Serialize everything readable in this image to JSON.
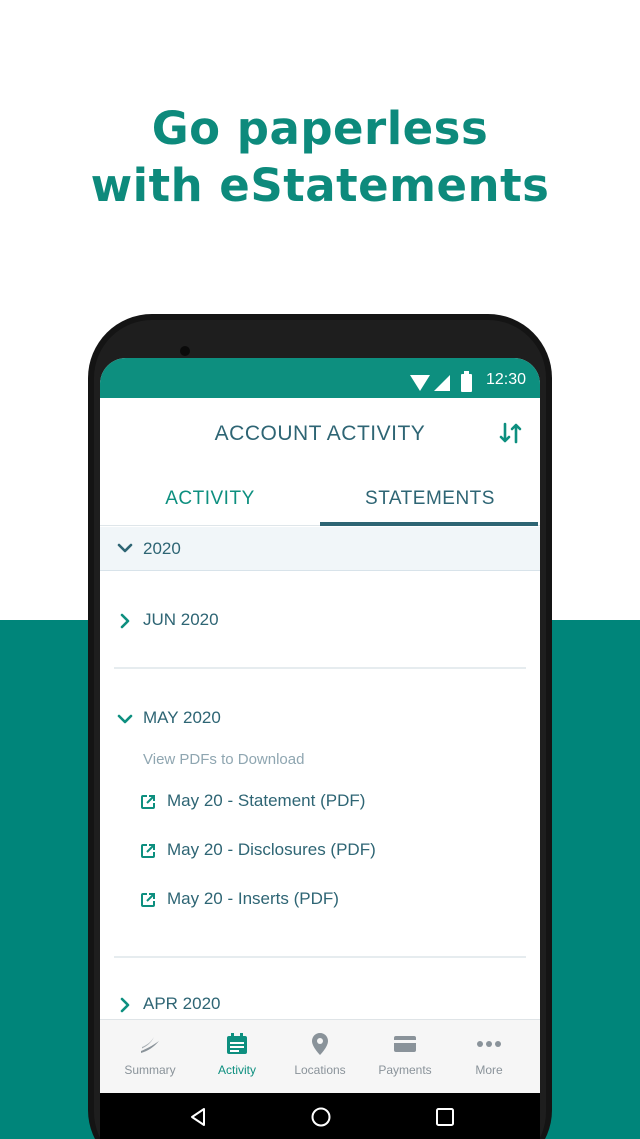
{
  "promo": {
    "headline_line1": "Go paperless",
    "headline_line2": "with eStatements"
  },
  "status_bar": {
    "time": "12:30",
    "icons": [
      "wifi-icon",
      "signal-icon",
      "battery-icon"
    ]
  },
  "header": {
    "title": "ACCOUNT ACTIVITY",
    "sort_icon": "sort-icon"
  },
  "tabs": [
    {
      "label": "ACTIVITY",
      "selected": false
    },
    {
      "label": "STATEMENTS",
      "selected": true
    }
  ],
  "statements": {
    "year": "2020",
    "months": [
      {
        "label": "JUN 2020",
        "expanded": false
      },
      {
        "label": "MAY 2020",
        "expanded": true
      },
      {
        "label": "APR 2020",
        "expanded": false
      }
    ],
    "hint": "View PDFs to Download",
    "pdfs": [
      "May 20 - Statement (PDF)",
      "May 20 - Disclosures (PDF)",
      "May 20 - Inserts (PDF)"
    ]
  },
  "bottom_nav": [
    {
      "label": "Summary",
      "icon": "summary-icon",
      "active": false
    },
    {
      "label": "Activity",
      "icon": "activity-icon",
      "active": true
    },
    {
      "label": "Locations",
      "icon": "location-pin-icon",
      "active": false
    },
    {
      "label": "Payments",
      "icon": "card-icon",
      "active": false
    },
    {
      "label": "More",
      "icon": "more-icon",
      "active": false
    }
  ],
  "colors": {
    "brand_teal": "#0d8f7f",
    "promo_bg": "#00857a",
    "text_dark_teal": "#2e6574",
    "inactive_gray": "#8a939a"
  }
}
